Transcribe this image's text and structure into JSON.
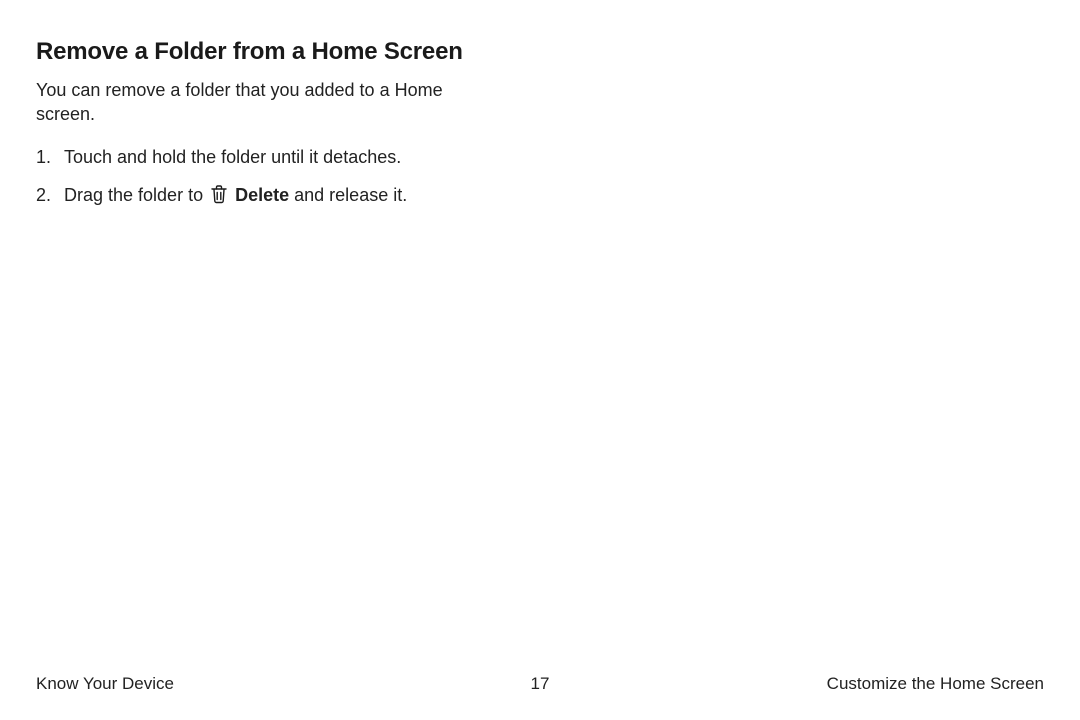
{
  "heading": "Remove a Folder from a Home Screen",
  "intro": "You can remove a folder that you added to a Home screen.",
  "steps": [
    {
      "num": "1.",
      "text": "Touch and hold the folder until it detaches."
    },
    {
      "num": "2.",
      "before": "Drag the folder to ",
      "bold": "Delete",
      "after": " and release it."
    }
  ],
  "footer": {
    "left": "Know Your Device",
    "center": "17",
    "right": "Customize the Home Screen"
  }
}
